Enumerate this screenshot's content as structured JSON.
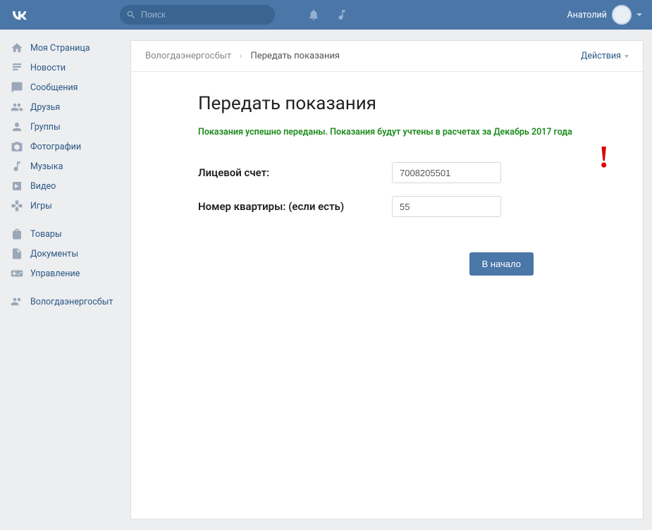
{
  "header": {
    "logo": "VK",
    "search_placeholder": "Поиск",
    "username": "Анатолий"
  },
  "sidebar": {
    "items": [
      {
        "label": "Моя Страница",
        "icon": "home"
      },
      {
        "label": "Новости",
        "icon": "news"
      },
      {
        "label": "Сообщения",
        "icon": "msg"
      },
      {
        "label": "Друзья",
        "icon": "friends"
      },
      {
        "label": "Группы",
        "icon": "groups"
      },
      {
        "label": "Фотографии",
        "icon": "photo"
      },
      {
        "label": "Музыка",
        "icon": "music"
      },
      {
        "label": "Видео",
        "icon": "video"
      },
      {
        "label": "Игры",
        "icon": "games"
      }
    ],
    "items2": [
      {
        "label": "Товары",
        "icon": "bag"
      },
      {
        "label": "Документы",
        "icon": "doc"
      },
      {
        "label": "Управление",
        "icon": "gamepad"
      }
    ],
    "items3": [
      {
        "label": "Вологдаэнергосбыт",
        "icon": "group"
      }
    ]
  },
  "breadcrumb": {
    "root": "Вологдаэнергосбыт",
    "current": "Передать показания",
    "actions_label": "Действия"
  },
  "main": {
    "title": "Передать показания",
    "success_msg": "Показания успешно переданы. Показания будут учтены в расчетах за Декабрь 2017 года",
    "account_label": "Лицевой счет:",
    "account_value": "7008205501",
    "apartment_label": "Номер квартиры: (если есть)",
    "apartment_value": "55",
    "back_btn": "В начало"
  }
}
